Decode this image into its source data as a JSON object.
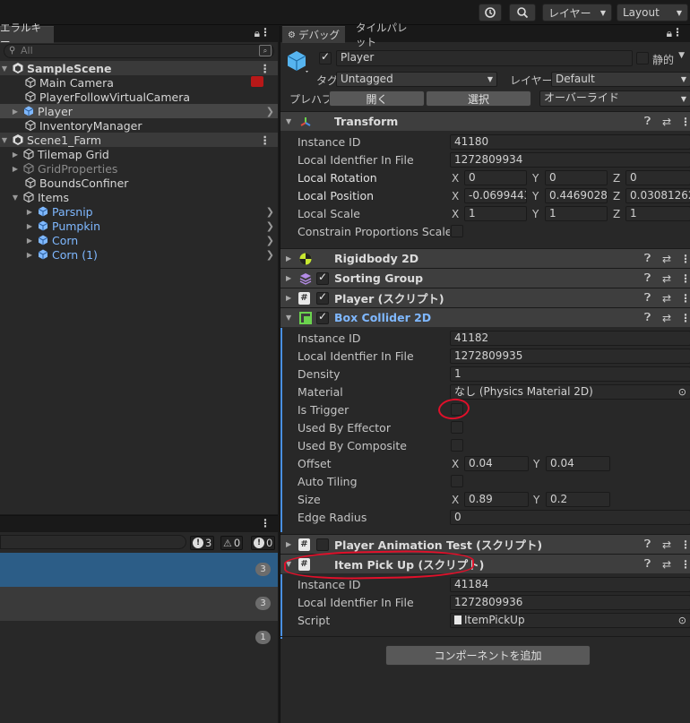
{
  "toolbar": {
    "search": "search-icon",
    "history": "history-icon",
    "layer_label": "レイヤー",
    "layout_label": "Layout"
  },
  "hierarchy": {
    "tab": "エラルキー",
    "search_placeholder": "All",
    "rows": [
      {
        "label": "SampleScene",
        "type": "scene"
      },
      {
        "label": "Main Camera",
        "type": "obj"
      },
      {
        "label": "PlayerFollowVirtualCamera",
        "type": "obj"
      },
      {
        "label": "Player",
        "type": "sel"
      },
      {
        "label": "InventoryManager",
        "type": "obj"
      },
      {
        "label": "Scene1_Farm",
        "type": "scene"
      },
      {
        "label": "Tilemap Grid",
        "type": "obj"
      },
      {
        "label": "GridProperties",
        "type": "dim"
      },
      {
        "label": "BoundsConfiner",
        "type": "obj"
      },
      {
        "label": "Items",
        "type": "obj"
      },
      {
        "label": "Parsnip",
        "type": "prefab"
      },
      {
        "label": "Pumpkin",
        "type": "prefab"
      },
      {
        "label": "Corn",
        "type": "prefab"
      },
      {
        "label": "Corn (1)",
        "type": "prefab"
      }
    ]
  },
  "console": {
    "count_log": "3",
    "count_warn": "0",
    "count_error": "0",
    "rows": [
      {
        "badge": "3",
        "selected": true
      },
      {
        "badge": "3",
        "selected": false
      },
      {
        "badge": "1",
        "selected": false
      }
    ]
  },
  "inspector": {
    "tabs": [
      "デバッグ",
      "タイルパレット"
    ],
    "object_name": "Player",
    "static_label": "静的",
    "tag_label": "タグ",
    "tag_value": "Untagged",
    "layer_label": "レイヤー",
    "layer_value": "Default",
    "prefab_label": "プレハブ",
    "open_btn": "開く",
    "select_btn": "選択",
    "override_btn": "オーバーライド",
    "transform": {
      "title": "Transform",
      "instance_id_label": "Instance ID",
      "instance_id": "41180",
      "local_id_label": "Local Identfier In File",
      "local_id": "1272809934",
      "rot_label": "Local Rotation",
      "rot": [
        "0",
        "0",
        "0"
      ],
      "pos_label": "Local Position",
      "pos": [
        "-0.06994436",
        "0.4469028",
        "0.03081262"
      ],
      "scale_label": "Local Scale",
      "scale": [
        "1",
        "1",
        "1"
      ],
      "constrain_label": "Constrain Proportions Scale"
    },
    "components": {
      "rb": "Rigidbody 2D",
      "sg": "Sorting Group",
      "ps": "Player (スクリプト)",
      "bc": "Box Collider 2D",
      "pat": "Player Animation Test (スクリプト)",
      "ipu": "Item Pick Up (スクリプト)"
    },
    "box": {
      "instance_id_label": "Instance ID",
      "instance_id": "41182",
      "local_id_label": "Local Identfier In File",
      "local_id": "1272809935",
      "density_label": "Density",
      "density": "1",
      "material_label": "Material",
      "material": "なし (Physics Material 2D)",
      "trigger_label": "Is Trigger",
      "effector_label": "Used By Effector",
      "composite_label": "Used By Composite",
      "offset_label": "Offset",
      "offset": [
        "0.04",
        "0.04"
      ],
      "tiling_label": "Auto Tiling",
      "size_label": "Size",
      "size": [
        "0.89",
        "0.2"
      ],
      "radius_label": "Edge Radius",
      "radius": "0"
    },
    "pickup": {
      "instance_id_label": "Instance ID",
      "instance_id": "41184",
      "local_id_label": "Local Identfier In File",
      "local_id": "1272809936",
      "script_label": "Script",
      "script": "ItemPickUp"
    },
    "add_component": "コンポーネントを追加"
  },
  "axes": {
    "x": "X",
    "y": "Y",
    "z": "Z"
  },
  "colors": {
    "accent": "#4a90e2",
    "annotation": "#e0102a",
    "prefab": "#7fb8ff"
  }
}
